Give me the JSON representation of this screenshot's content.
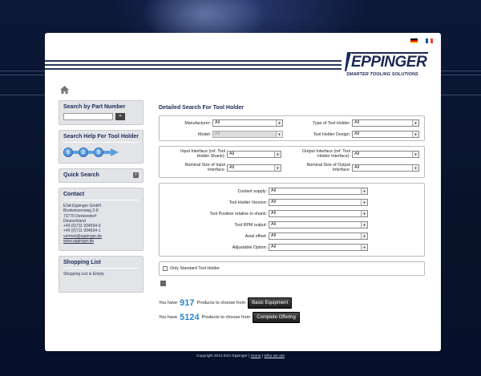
{
  "header": {
    "brand": "EPPINGER",
    "tagline": "SMARTER TOOLING SOLUTIONS",
    "flag_sep": "...",
    "languages": [
      "de",
      "fr"
    ]
  },
  "sidebar": {
    "part_search": {
      "title": "Search by Part Number",
      "go_label": "»"
    },
    "search_help": {
      "title": "Search Help For Tool Holder",
      "steps": [
        "1",
        "2",
        "3"
      ]
    },
    "quick_search": {
      "title": "Quick Search",
      "toggle": "+"
    },
    "contact": {
      "title": "Contact",
      "lines": [
        "ESA Eppinger GmbH",
        "Breitwiesenweg 2-8",
        "73770 Denkendorf",
        "Deutschland",
        "+49 (0)711 934934-0",
        "+49 (0)711 934934-1"
      ],
      "email": "vertrieb@eppinger.de",
      "website": "www.eppinger.de"
    },
    "shopping_list": {
      "title": "Shopping List",
      "status": "Shopping List is Empty"
    }
  },
  "main": {
    "title": "Detailed Search For Tool Holder",
    "panel1": {
      "manufacturer": {
        "label": "Manufacturer:",
        "value": "All"
      },
      "model": {
        "label": "Model:",
        "value": "All"
      },
      "type": {
        "label": "Type of Tool Holder:",
        "value": "All"
      },
      "design": {
        "label": "Tool Holder Design:",
        "value": "All"
      }
    },
    "panel2": {
      "input_interface": {
        "label1": "Input Interface (ref. Tool",
        "label2": "Holder Shank):",
        "value": "All"
      },
      "nominal_input": {
        "label1": "Nominal Size of Input",
        "label2": "Interface:",
        "value": "All"
      },
      "output_interface": {
        "label1": "Output Interface (ref. Tool",
        "label2": "Holder Interface):",
        "value": "All"
      },
      "nominal_output": {
        "label1": "Nominal Size of Output",
        "label2": "Interface:",
        "value": "All"
      }
    },
    "panel3": [
      {
        "label": "Coolant supply:",
        "value": "All"
      },
      {
        "label": "Tool Holder Version:",
        "value": "All"
      },
      {
        "label": "Tool Position relative to shank:",
        "value": "All"
      },
      {
        "label": "Tool RPM output:",
        "value": "All"
      },
      {
        "label": "Axial offset:",
        "value": "All"
      },
      {
        "label": "Adjustable Option:",
        "value": "All"
      }
    ],
    "only_standard": "Only Standard Tool Holder",
    "results": {
      "basic": {
        "prefix": "You have",
        "count": "917",
        "suffix": "Products to choose from",
        "button": "Basic Equipment"
      },
      "complete": {
        "prefix": "You have",
        "count": "5124",
        "suffix": "Products to choose from",
        "button": "Complete Offering"
      }
    }
  },
  "footer": {
    "copyright": "Copyright 2012 ESA Eppinger |",
    "home": "Home",
    "sep": "|",
    "who": "Who we are"
  }
}
